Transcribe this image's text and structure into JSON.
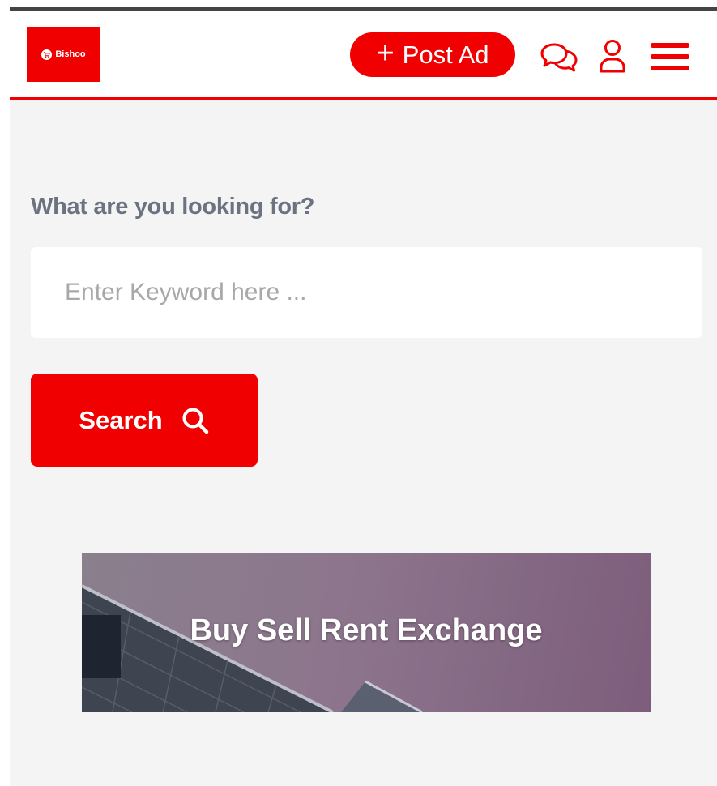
{
  "header": {
    "logo_text": "Bishoo",
    "post_ad_plus": "+",
    "post_ad_label": "Post Ad",
    "icons": [
      "chat-icon",
      "user-icon",
      "menu-icon"
    ]
  },
  "search": {
    "question": "What are you looking for?",
    "placeholder": "Enter Keyword here ...",
    "button_label": "Search",
    "button_icon": "search-icon"
  },
  "banner": {
    "title": "Buy Sell Rent Exchange"
  },
  "colors": {
    "brand": "#f00000",
    "background": "#f4f4f4",
    "text_muted": "#6b7280"
  }
}
